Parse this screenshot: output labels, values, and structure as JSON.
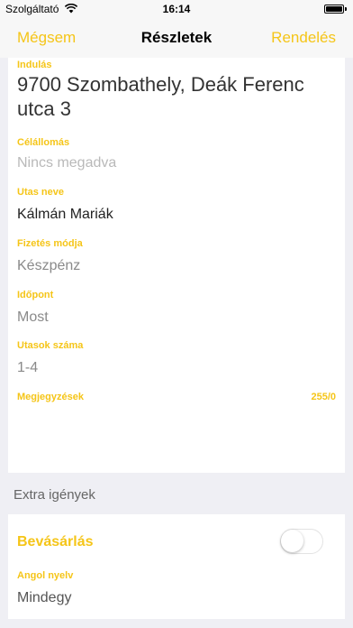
{
  "status_bar": {
    "carrier": "Szolgáltató",
    "time": "16:14",
    "wifi_icon": "wifi-icon",
    "battery_icon": "battery-icon"
  },
  "nav": {
    "cancel": "Mégsem",
    "title": "Részletek",
    "order": "Rendelés"
  },
  "form": {
    "origin": {
      "label": "Indulás",
      "value": "9700 Szombathely, Deák Ferenc utca 3"
    },
    "destination": {
      "label": "Célállomás",
      "placeholder": "Nincs megadva"
    },
    "passenger_name": {
      "label": "Utas neve",
      "value": "Kálmán Mariák"
    },
    "payment": {
      "label": "Fizetés módja",
      "value": "Készpénz"
    },
    "time": {
      "label": "Időpont",
      "value": "Most"
    },
    "passenger_count": {
      "label": "Utasok száma",
      "value": "1-4"
    },
    "notes": {
      "label": "Megjegyzések",
      "counter": "255/0",
      "value": ""
    }
  },
  "extras": {
    "section_title": "Extra igények",
    "shopping": {
      "label": "Bevásárlás",
      "on": false
    },
    "english": {
      "label": "Angol nyelv",
      "value": "Mindegy"
    }
  },
  "colors": {
    "accent": "#f5c518",
    "background": "#efeff4",
    "placeholder": "#b9b9b9"
  }
}
